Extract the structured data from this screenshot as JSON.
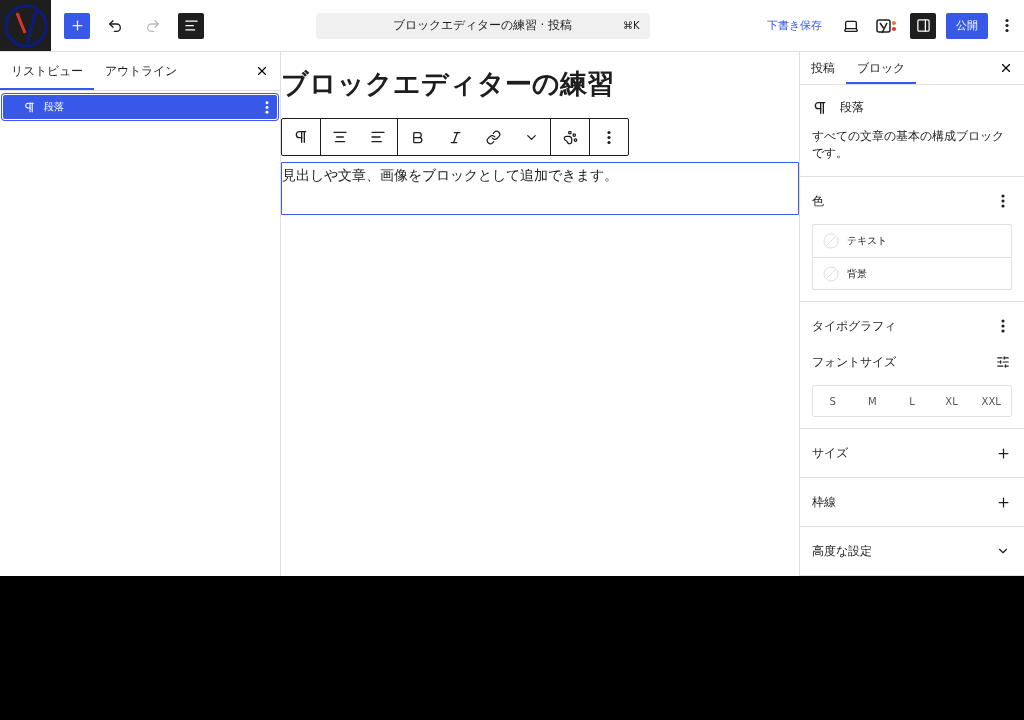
{
  "top_bar": {
    "document_title": "ブロックエディターの練習 · 投稿",
    "shortcut": "⌘K",
    "save_draft": "下書き保存",
    "publish": "公開",
    "redo_disabled": true,
    "settings_open": true
  },
  "left_panel": {
    "tabs": [
      {
        "label": "リストビュー",
        "selected": true
      },
      {
        "label": "アウトライン",
        "selected": false
      }
    ],
    "items": [
      {
        "label": "段落",
        "selected": true
      }
    ]
  },
  "editor": {
    "heading": "ブロックエディターの練習",
    "paragraph": "見出しや文章、画像をブロックとして追加できます。"
  },
  "right_panel": {
    "tabs": [
      {
        "label": "投稿",
        "selected": false
      },
      {
        "label": "ブロック",
        "selected": true
      }
    ],
    "block": {
      "name": "段落",
      "description": "すべての文章の基本の構成ブロックです。"
    },
    "sections": [
      {
        "kind": "color",
        "title": "色",
        "items": [
          "テキスト",
          "背景"
        ]
      },
      {
        "kind": "typography",
        "title": "タイポグラフィ",
        "font_size_label": "フォントサイズ",
        "sizes": [
          "S",
          "M",
          "L",
          "XL",
          "XXL"
        ]
      },
      {
        "kind": "collapsed",
        "title": "サイズ"
      },
      {
        "kind": "collapsed",
        "title": "枠線"
      },
      {
        "kind": "advanced",
        "title": "高度な設定"
      }
    ]
  }
}
